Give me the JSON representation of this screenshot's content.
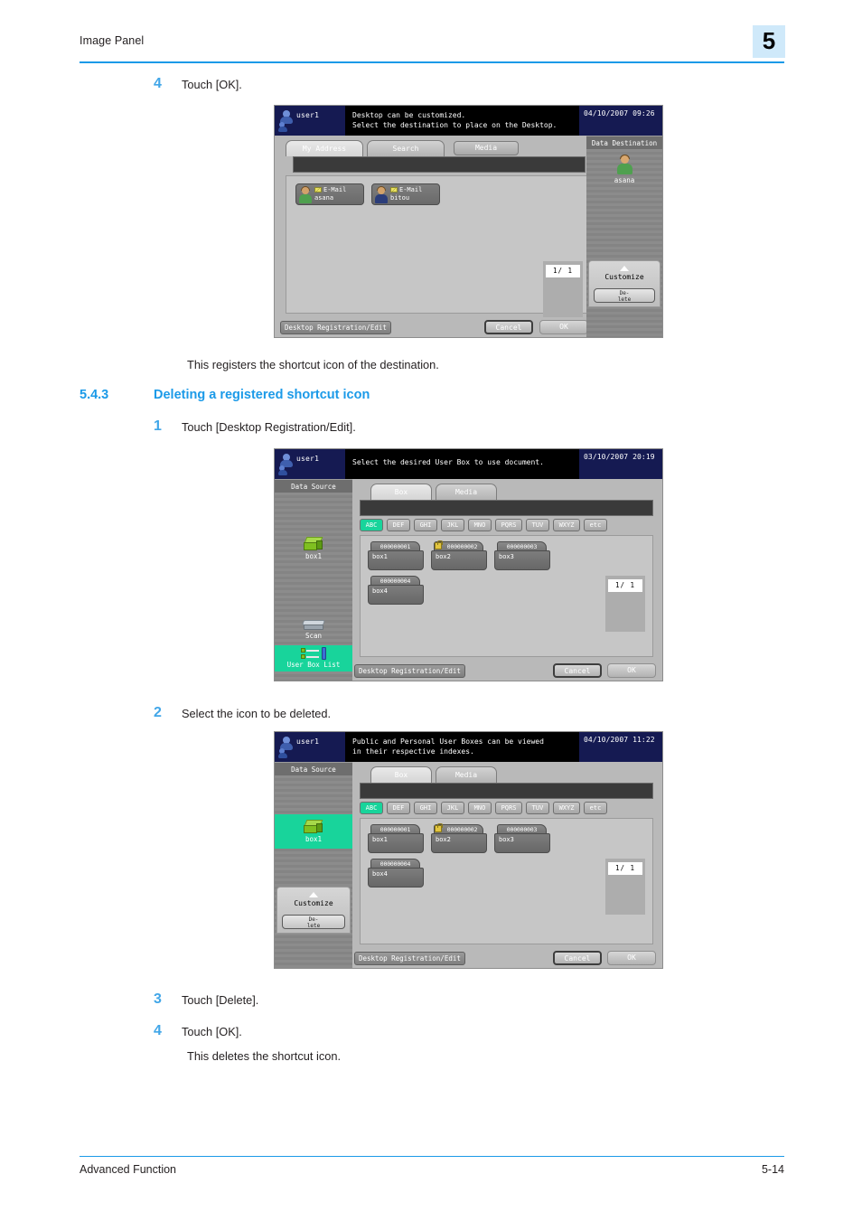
{
  "header": {
    "title": "Image Panel",
    "chapter": "5"
  },
  "footer": {
    "left": "Advanced Function",
    "right": "5-14"
  },
  "steps": {
    "s4a": {
      "num": "4",
      "text": "Touch [OK]."
    },
    "result1": "This registers the shortcut icon of the destination.",
    "section": {
      "num": "5.4.3",
      "title": "Deleting a registered shortcut icon"
    },
    "s1": {
      "num": "1",
      "text": "Touch [Desktop Registration/Edit]."
    },
    "s2": {
      "num": "2",
      "text": "Select the icon to be deleted."
    },
    "s3": {
      "num": "3",
      "text": "Touch [Delete]."
    },
    "s4b": {
      "num": "4",
      "text": "Touch [OK]."
    },
    "result2": "This deletes the shortcut icon."
  },
  "panel1": {
    "user": "user1",
    "message": "Desktop can be customized.\nSelect the destination to place on the Desktop.",
    "datetime": "04/10/2007  09:26",
    "tabs": [
      {
        "label": "My Address",
        "state": "active"
      },
      {
        "label": "Search",
        "state": "normal"
      },
      {
        "label": "Media",
        "state": "raised"
      }
    ],
    "search_value": "",
    "addresses": [
      {
        "type": "E-Mail",
        "name": "asana",
        "avatar": "green"
      },
      {
        "type": "E-Mail",
        "name": "bitou",
        "avatar": "blue"
      }
    ],
    "page_indicator": "1/  1",
    "sidebar": {
      "title": "Data Destination",
      "entry_label": "asana",
      "customize_label": "Customize",
      "delete_label": "De-\nlete"
    },
    "bottom": {
      "desktop_reg": "Desktop Registration/Edit",
      "cancel": "Cancel",
      "ok": "OK"
    }
  },
  "panel2": {
    "user": "user1",
    "message": "Select the desired User Box to use document.",
    "datetime": "03/10/2007  20:19",
    "tabs": [
      {
        "label": "Box",
        "state": "active"
      },
      {
        "label": "Media",
        "state": "normal"
      }
    ],
    "search_value": "",
    "index_tabs": [
      "ABC",
      "DEF",
      "GHI",
      "JKL",
      "MNO",
      "PQRS",
      "TUV",
      "WXYZ",
      "etc"
    ],
    "index_selected": "ABC",
    "boxes": [
      {
        "number": "000000001",
        "name": "box1",
        "locked": false
      },
      {
        "number": "000000002",
        "name": "box2",
        "locked": true
      },
      {
        "number": "000000003",
        "name": "box3",
        "locked": false
      },
      {
        "number": "000000004",
        "name": "box4",
        "locked": false
      }
    ],
    "page_indicator": "1/  1",
    "sidebar": {
      "title": "Data Source",
      "items": [
        {
          "label": "box1",
          "icon": "box-icon",
          "selected": false
        },
        {
          "label": "Scan",
          "icon": "scanner-icon",
          "selected": false
        },
        {
          "label": "User Box List",
          "icon": "user-box-list-icon",
          "selected": true
        }
      ]
    },
    "bottom": {
      "desktop_reg": "Desktop Registration/Edit",
      "cancel": "Cancel",
      "ok": "OK"
    }
  },
  "panel3": {
    "user": "user1",
    "message": "Public and Personal User Boxes can be viewed\nin their respective indexes.",
    "datetime": "04/10/2007  11:22",
    "tabs": [
      {
        "label": "Box",
        "state": "active"
      },
      {
        "label": "Media",
        "state": "normal"
      }
    ],
    "search_value": "",
    "index_tabs": [
      "ABC",
      "DEF",
      "GHI",
      "JKL",
      "MNO",
      "PQRS",
      "TUV",
      "WXYZ",
      "etc"
    ],
    "index_selected": "ABC",
    "boxes": [
      {
        "number": "000000001",
        "name": "box1",
        "locked": false
      },
      {
        "number": "000000002",
        "name": "box2",
        "locked": true
      },
      {
        "number": "000000003",
        "name": "box3",
        "locked": false
      },
      {
        "number": "000000004",
        "name": "box4",
        "locked": false
      }
    ],
    "page_indicator": "1/  1",
    "sidebar": {
      "title": "Data Source",
      "entry_label": "box1",
      "customize_label": "Customize",
      "delete_label": "De-\nlete"
    },
    "bottom": {
      "desktop_reg": "Desktop Registration/Edit",
      "cancel": "Cancel",
      "ok": "OK"
    }
  },
  "colors": {
    "accent": "#1b9ae8",
    "step_number": "#41a6e8",
    "badge_bg": "#cfe9fa",
    "lcd_select": "#18d49b"
  }
}
